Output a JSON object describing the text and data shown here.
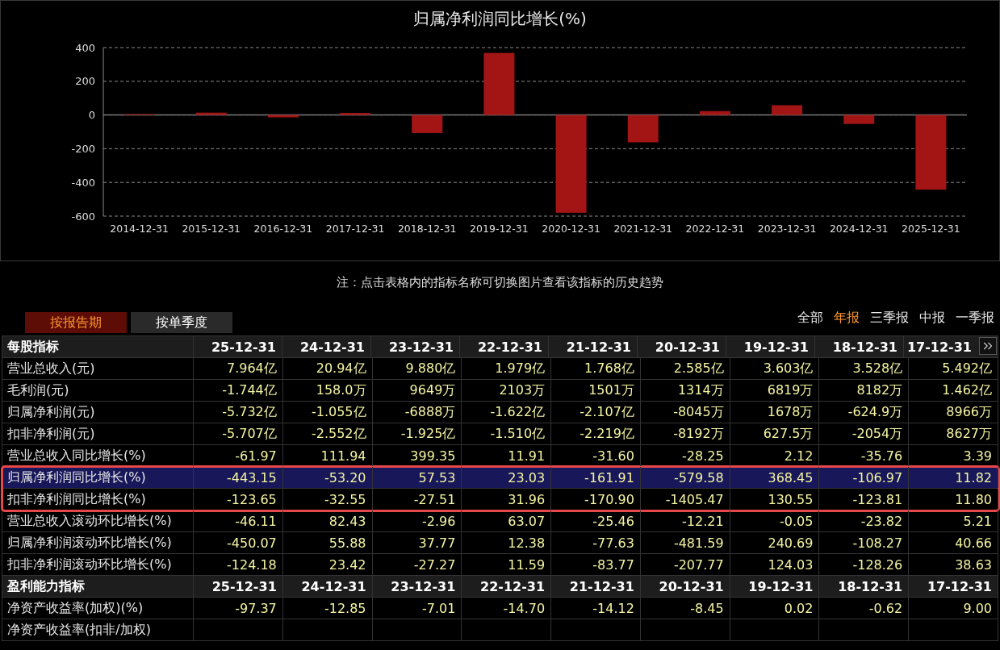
{
  "chart": {
    "chart_data": [
      {
        "type": "bar",
        "title": "归属净利润同比增长(%)",
        "categories": [
          "2014-12-31",
          "2015-12-31",
          "2016-12-31",
          "2017-12-31",
          "2018-12-31",
          "2019-12-31",
          "2020-12-31",
          "2021-12-31",
          "2022-12-31",
          "2023-12-31",
          "2024-12-31",
          "2025-12-31"
        ],
        "values": [
          5,
          14,
          -14,
          12,
          -107,
          368,
          -580,
          -162,
          23,
          58,
          -53,
          -443
        ],
        "color": "#a31515",
        "yticks": [
          -600,
          -400,
          -200,
          0,
          200,
          400
        ],
        "ylim": [
          -600,
          400
        ],
        "grid": true
      }
    ]
  },
  "note": "注：点击表格内的指标名称可切换图片查看该指标的历史趋势",
  "period_tabs": [
    {
      "label": "按报告期",
      "selected": true
    },
    {
      "label": "按单季度",
      "selected": false
    }
  ],
  "report_filters": [
    {
      "label": "全部",
      "selected": false
    },
    {
      "label": "年报",
      "selected": true
    },
    {
      "label": "三季报",
      "selected": false
    },
    {
      "label": "中报",
      "selected": false
    },
    {
      "label": "一季报",
      "selected": false
    }
  ],
  "table": {
    "sections": [
      {
        "title": "每股指标",
        "columns": [
          "25-12-31",
          "24-12-31",
          "23-12-31",
          "22-12-31",
          "21-12-31",
          "20-12-31",
          "19-12-31",
          "18-12-31",
          "17-12-31"
        ],
        "rows": [
          {
            "name": "营业总收入(元)",
            "values": [
              "7.964亿",
              "20.94亿",
              "9.880亿",
              "1.979亿",
              "1.768亿",
              "2.585亿",
              "3.603亿",
              "3.528亿",
              "5.492亿"
            ],
            "selected": false,
            "outlined": false
          },
          {
            "name": "毛利润(元)",
            "values": [
              "-1.744亿",
              "158.0万",
              "9649万",
              "2103万",
              "1501万",
              "1314万",
              "6819万",
              "8182万",
              "1.462亿"
            ],
            "selected": false,
            "outlined": false
          },
          {
            "name": "归属净利润(元)",
            "values": [
              "-5.732亿",
              "-1.055亿",
              "-6888万",
              "-1.622亿",
              "-2.107亿",
              "-8045万",
              "1678万",
              "-624.9万",
              "8966万"
            ],
            "selected": false,
            "outlined": false
          },
          {
            "name": "扣非净利润(元)",
            "values": [
              "-5.707亿",
              "-2.552亿",
              "-1.925亿",
              "-1.510亿",
              "-2.219亿",
              "-8192万",
              "627.5万",
              "-2054万",
              "8627万"
            ],
            "selected": false,
            "outlined": false
          },
          {
            "name": "营业总收入同比增长(%)",
            "values": [
              "-61.97",
              "111.94",
              "399.35",
              "11.91",
              "-31.60",
              "-28.25",
              "2.12",
              "-35.76",
              "3.39"
            ],
            "selected": false,
            "outlined": false
          },
          {
            "name": "归属净利润同比增长(%)",
            "values": [
              "-443.15",
              "-53.20",
              "57.53",
              "23.03",
              "-161.91",
              "-579.58",
              "368.45",
              "-106.97",
              "11.82"
            ],
            "selected": true,
            "outlined": true
          },
          {
            "name": "扣非净利润同比增长(%)",
            "values": [
              "-123.65",
              "-32.55",
              "-27.51",
              "31.96",
              "-170.90",
              "-1405.47",
              "130.55",
              "-123.81",
              "11.80"
            ],
            "selected": false,
            "outlined": true
          },
          {
            "name": "营业总收入滚动环比增长(%)",
            "values": [
              "-46.11",
              "82.43",
              "-2.96",
              "63.07",
              "-25.46",
              "-12.21",
              "-0.05",
              "-23.82",
              "5.21"
            ],
            "selected": false,
            "outlined": false
          },
          {
            "name": "归属净利润滚动环比增长(%)",
            "values": [
              "-450.07",
              "55.88",
              "37.77",
              "12.38",
              "-77.63",
              "-481.59",
              "240.69",
              "-108.27",
              "40.66"
            ],
            "selected": false,
            "outlined": false
          },
          {
            "name": "扣非净利润滚动环比增长(%)",
            "values": [
              "-124.18",
              "23.42",
              "-27.27",
              "11.59",
              "-83.77",
              "-207.77",
              "124.03",
              "-128.26",
              "38.63"
            ],
            "selected": false,
            "outlined": false
          }
        ]
      },
      {
        "title": "盈利能力指标",
        "columns": [
          "25-12-31",
          "24-12-31",
          "23-12-31",
          "22-12-31",
          "21-12-31",
          "20-12-31",
          "19-12-31",
          "18-12-31",
          "17-12-31"
        ],
        "rows": [
          {
            "name": "净资产收益率(加权)(%)",
            "values": [
              "-97.37",
              "-12.85",
              "-7.01",
              "-14.70",
              "-14.12",
              "-8.45",
              "0.02",
              "-0.62",
              "9.00"
            ],
            "selected": false,
            "outlined": false
          },
          {
            "name": "净资产收益率(扣非/加权)",
            "selected": false,
            "outlined": false
          }
        ]
      }
    ]
  }
}
